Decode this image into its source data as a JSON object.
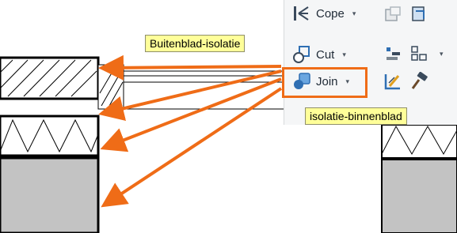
{
  "ribbon": {
    "cope": {
      "label": "Cope",
      "caret": "▾",
      "icon": "cope-icon"
    },
    "cut": {
      "label": "Cut",
      "caret": "▾",
      "icon": "cut-icon"
    },
    "join": {
      "label": "Join",
      "caret": "▾",
      "icon": "join-icon"
    },
    "small_tools": [
      "split-face-icon",
      "paint-icon",
      "align-icon",
      "linework-icon",
      "demolish-icon",
      "wall-joins-icon"
    ]
  },
  "callouts": {
    "top": "Buitenblad-isolatie",
    "bottom": "isolatie-binnenblad"
  },
  "colors": {
    "arrow": "#ef6c17",
    "callout_bg": "#ffff99",
    "masonry": "#c3c3c3",
    "ribbon_bg": "#f5f6f7"
  }
}
